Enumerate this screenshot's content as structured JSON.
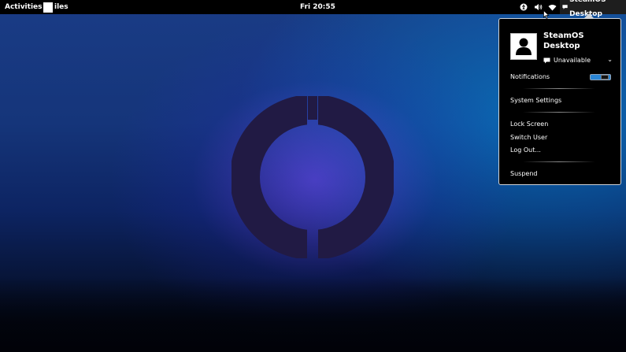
{
  "topbar": {
    "activities_label": "Activities",
    "app_menu_label": "iles",
    "clock": "Fri 20:55",
    "tray_icons": [
      "accessibility-icon",
      "volume-icon",
      "wifi-icon"
    ],
    "user_button_label": "SteamOS Desktop"
  },
  "user_menu": {
    "user_name": "SteamOS Desktop",
    "presence_status": "Unavailable",
    "notifications_label": "Notifications",
    "notifications_toggle_on": true,
    "system_settings_label": "System Settings",
    "lock_screen_label": "Lock Screen",
    "switch_user_label": "Switch User",
    "log_out_label": "Log Out...",
    "suspend_label": "Suspend"
  },
  "colors": {
    "topbar_bg": "#000000",
    "toggle_accent": "#2a86d6",
    "logo_ring": "#211a44"
  }
}
